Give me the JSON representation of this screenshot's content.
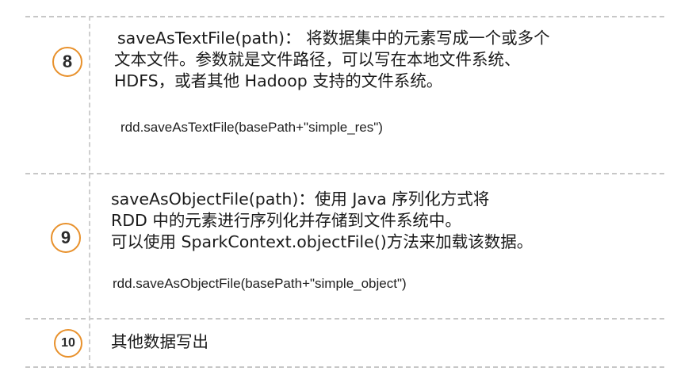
{
  "rows": [
    {
      "number": "8",
      "description_lines": [
        "saveAsTextFile(path)： 将数据集中的元素写成一个或多个",
        "文本文件。参数就是文件路径，可以写在本地文件系统、",
        "HDFS，或者其他 Hadoop 支持的文件系统。"
      ],
      "code": "rdd.saveAsTextFile(basePath+\"simple_res\")"
    },
    {
      "number": "9",
      "description_lines": [
        "saveAsObjectFile(path)：使用 Java 序列化方式将",
        "RDD 中的元素进行序列化并存储到文件系统中。",
        "可以使用 SparkContext.objectFile()方法来加载该数据。"
      ],
      "code": "rdd.saveAsObjectFile(basePath+\"simple_object\")"
    },
    {
      "number": "10",
      "description_lines": [
        "其他数据写出"
      ],
      "code": ""
    }
  ],
  "colors": {
    "circle_border": "#e8912c",
    "divider": "#c7c7c7",
    "text": "#1a1a1a"
  }
}
